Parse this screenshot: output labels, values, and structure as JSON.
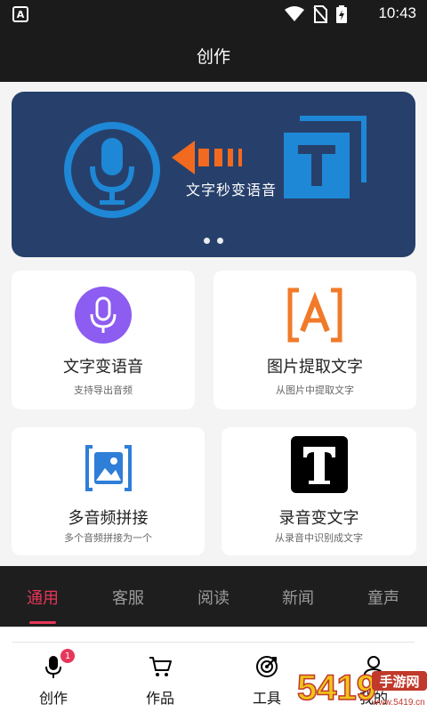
{
  "status_bar": {
    "time": "10:43",
    "app_badge": "A"
  },
  "header": {
    "title": "创作"
  },
  "banner": {
    "caption": "文字秒变语音",
    "page_count": 2,
    "current_page": 1
  },
  "cards": [
    {
      "title": "文字变语音",
      "subtitle": "支持导出音频",
      "icon": "microphone-icon"
    },
    {
      "title": "图片提取文字",
      "subtitle": "从图片中提取文字",
      "icon": "text-recognition-icon"
    },
    {
      "title": "多音频拼接",
      "subtitle": "多个音频拼接为一个",
      "icon": "image-frame-icon"
    },
    {
      "title": "录音变文字",
      "subtitle": "从录音中识别成文字",
      "icon": "letter-t-icon"
    }
  ],
  "tabs": [
    "通用",
    "客服",
    "阅读",
    "新闻",
    "童声"
  ],
  "active_tab": 0,
  "bottom_nav": [
    {
      "label": "创作",
      "icon": "mic-icon",
      "badge": "1"
    },
    {
      "label": "作品",
      "icon": "cart-icon"
    },
    {
      "label": "工具",
      "icon": "target-icon"
    },
    {
      "label": "我的",
      "icon": "user-icon"
    }
  ],
  "watermark": {
    "digits": "5419",
    "cn": "手游网",
    "url": "www.5419.cn"
  },
  "colors": {
    "accent": "#e8365a",
    "banner_bg": "#27406b",
    "banner_blue": "#1e88d6",
    "banner_orange": "#f26a1f",
    "dark_bar": "#1b1b1b"
  }
}
